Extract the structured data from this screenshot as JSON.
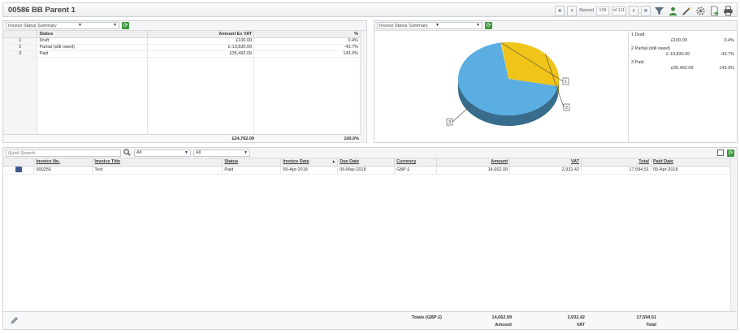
{
  "header": {
    "title": "00586 BB Parent 1"
  },
  "nav": {
    "first": "«",
    "prev": "‹",
    "record_label": "Record",
    "record_value": "109",
    "of_label": "of 111",
    "next": "›",
    "last": "»"
  },
  "summary": {
    "select_label": "Invoice Status Summary",
    "columns": {
      "status": "Status",
      "amount": "Amount Ex VAT",
      "pct": "%"
    },
    "rows": [
      {
        "num": "1",
        "status": "Draft",
        "amount": "£100.00",
        "pct": "0.4%"
      },
      {
        "num": "2",
        "status": "Partial (still owed)",
        "amount": "£-10,830.00",
        "pct": "-43.7%"
      },
      {
        "num": "3",
        "status": "Paid",
        "amount": "£35,492.09",
        "pct": "143.3%"
      }
    ],
    "total_amount": "£24,762.09",
    "total_pct": "100.0%"
  },
  "chart_panel": {
    "select_label": "Invoice Status Summary",
    "legend": [
      {
        "label": "1  Draft",
        "amount": "£100.00",
        "pct": "0.4%"
      },
      {
        "label": "2  Partial (still owed)",
        "amount": "£-10,830.00",
        "pct": "-43.7%"
      },
      {
        "label": "3  Paid",
        "amount": "£35,492.09",
        "pct": "143.3%"
      }
    ]
  },
  "chart_data": {
    "type": "pie",
    "categories": [
      "1",
      "2",
      "3"
    ],
    "values": [
      100.0,
      -10830.0,
      35492.09
    ],
    "slice_fractions": [
      0.003,
      0.304,
      0.693
    ],
    "colors": [
      "#ffd54a",
      "#f0c419",
      "#5aaee2"
    ],
    "labels": [
      "1",
      "2",
      "3"
    ]
  },
  "grid": {
    "quick_search_placeholder": "Quick Search",
    "filter1": "All",
    "filter2": "All",
    "columns": {
      "invoice_no": "Invoice No.",
      "title": "Invoice Title",
      "status": "Status",
      "invoice_date": "Invoice Date",
      "due_date": "Due Date",
      "currency": "Currency",
      "amount": "Amount",
      "vat": "VAT",
      "total": "Total",
      "paid_date": "Paid Date"
    },
    "rows": [
      {
        "invoice_no": "000256",
        "title": "Test",
        "status": "Paid",
        "invoice_date": "05-Apr-2018",
        "due_date": "05-May-2018",
        "currency": "GBP £",
        "amount": "14,662.09",
        "vat": "2,932.42",
        "total": "17,594.51",
        "paid_date": "05-Apr-2018"
      }
    ],
    "totals": {
      "label": "Totals (GBP £)",
      "amount": "14,662.09",
      "vat": "2,932.42",
      "total": "17,594.51",
      "amount_label": "Amount",
      "vat_label": "VAT",
      "total_label": "Total"
    }
  }
}
